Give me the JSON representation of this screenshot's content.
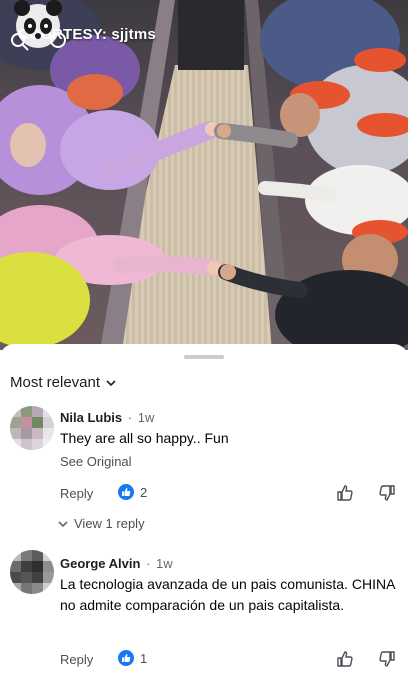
{
  "video": {
    "watermark": "COURTESY: sjjtms"
  },
  "comments_panel": {
    "sort_label": "Most relevant",
    "comments": [
      {
        "author": "Nila Lubis",
        "time": "1w",
        "text": "They are all so happy.. Fun",
        "see_original": "See Original",
        "reply_label": "Reply",
        "reaction_count": "2",
        "view_replies": "View 1 reply"
      },
      {
        "author": "George Alvin",
        "time": "1w",
        "text": "La tecnologia avanzada de un pais comunista. CHINA  no admite comparación de un pais capitalista.",
        "reply_label": "Reply",
        "reaction_count": "1"
      }
    ]
  },
  "colors": {
    "accent_blue": "#1877f2",
    "secondary_text": "#65676b"
  },
  "icons": [
    "panda-logo-icon",
    "chevron-down-icon",
    "like-reaction-icon",
    "thumbs-up-icon",
    "thumbs-down-icon",
    "reply-arrow-icon"
  ]
}
